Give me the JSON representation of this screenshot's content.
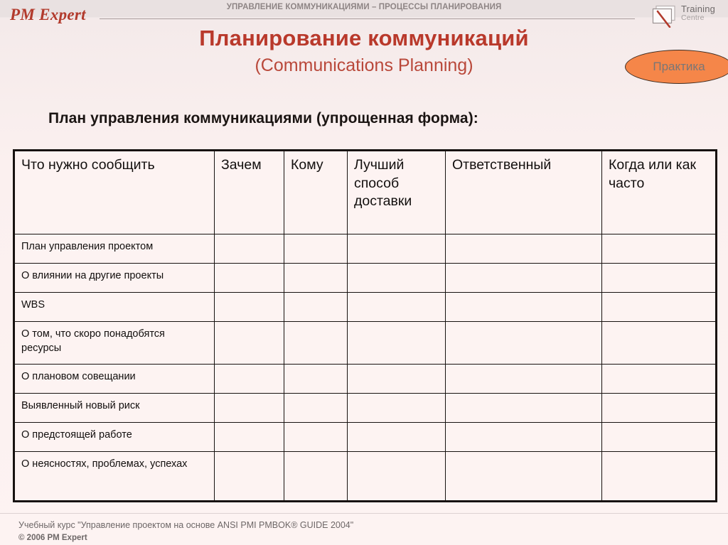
{
  "header": {
    "brand": "PM Expert",
    "kicker": "УПРАВЛЕНИЕ КОММУНИКАЦИЯМИ – ПРОЦЕССЫ ПЛАНИРОВАНИЯ",
    "logo": {
      "line1": "Training",
      "line2": "Centre",
      "icon": "flipchart-pen-icon"
    }
  },
  "title": {
    "ru": "Планирование коммуникаций",
    "en": "(Communications Planning)"
  },
  "badge": {
    "label": "Практика"
  },
  "subtitle": "План управления коммуникациями (упрощенная форма):",
  "table": {
    "columns": [
      "Что нужно сообщить",
      "Зачем",
      "Кому",
      "Лучший способ доставки",
      "Ответственный",
      "Когда или как часто"
    ],
    "rows": [
      {
        "label": "План управления проектом",
        "size": "short"
      },
      {
        "label": "О влиянии на другие проекты",
        "size": "short"
      },
      {
        "label": "WBS",
        "size": "short"
      },
      {
        "label": "О том, что скоро понадобятся ресурсы",
        "size": "tall"
      },
      {
        "label": "О плановом совещании",
        "size": "short"
      },
      {
        "label": "Выявленный новый риск",
        "size": "short"
      },
      {
        "label": "О предстоящей работе",
        "size": "short"
      },
      {
        "label": "О неясностях, проблемах, успехах",
        "size": "last"
      }
    ],
    "empty_cell": ""
  },
  "footer": {
    "line1": "Учебный курс \"Управление проектом на основе ANSI PMI PMBOK® GUIDE 2004\"",
    "line2": "© 2006 PM Expert"
  },
  "colors": {
    "brand_red": "#b23a2c",
    "title_red": "#b9392b",
    "badge_orange": "#f58649",
    "background": "#fbf0ef",
    "header_band": "#e9e1e1",
    "table_border": "#171210"
  }
}
